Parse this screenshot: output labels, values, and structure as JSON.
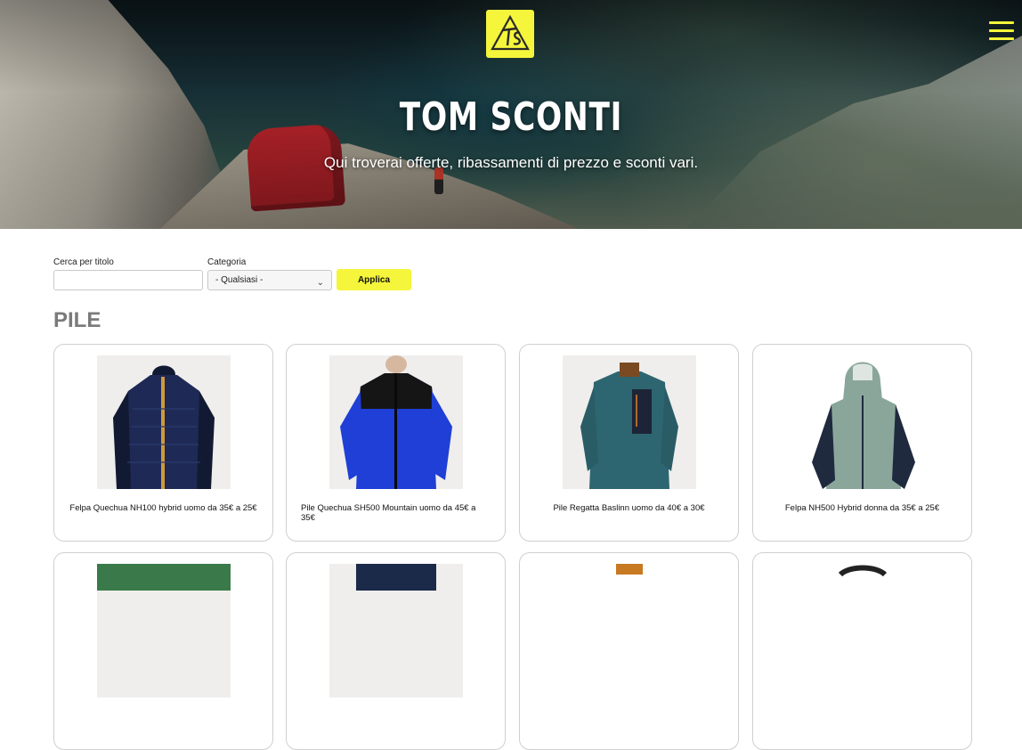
{
  "header": {
    "logo_text": "TS",
    "title": "TOM SCONTI",
    "subtitle": "Qui troverai offerte, ribassamenti di prezzo e sconti vari."
  },
  "filters": {
    "title_label": "Cerca per titolo",
    "title_value": "",
    "category_label": "Categoria",
    "category_value": "- Qualsiasi -",
    "apply_label": "Applica"
  },
  "section": {
    "title": "PILE"
  },
  "products": [
    {
      "name": "Felpa Quechua NH100 hybrid uomo da 35€ a 25€",
      "align": "center",
      "colors": [
        "#1e2a55",
        "#111a33",
        "#d09a3a"
      ]
    },
    {
      "name": "Pile Quechua SH500 Mountain uomo da 45€ a 35€",
      "align": "left",
      "colors": [
        "#1f3fd6",
        "#151515",
        "#1a1a1a"
      ]
    },
    {
      "name": "Pile Regatta Baslinn uomo da 40€ a 30€",
      "align": "center",
      "colors": [
        "#2d6670",
        "#1e2437",
        "#7a4a22"
      ]
    },
    {
      "name": "Felpa NH500 Hybrid donna da 35€ a 25€",
      "align": "center",
      "colors": [
        "#8aa69a",
        "#1f2a3e",
        "#dfe6e2"
      ]
    }
  ],
  "colors": {
    "accent": "#f5f53b",
    "section_title": "#7a7a7a"
  }
}
